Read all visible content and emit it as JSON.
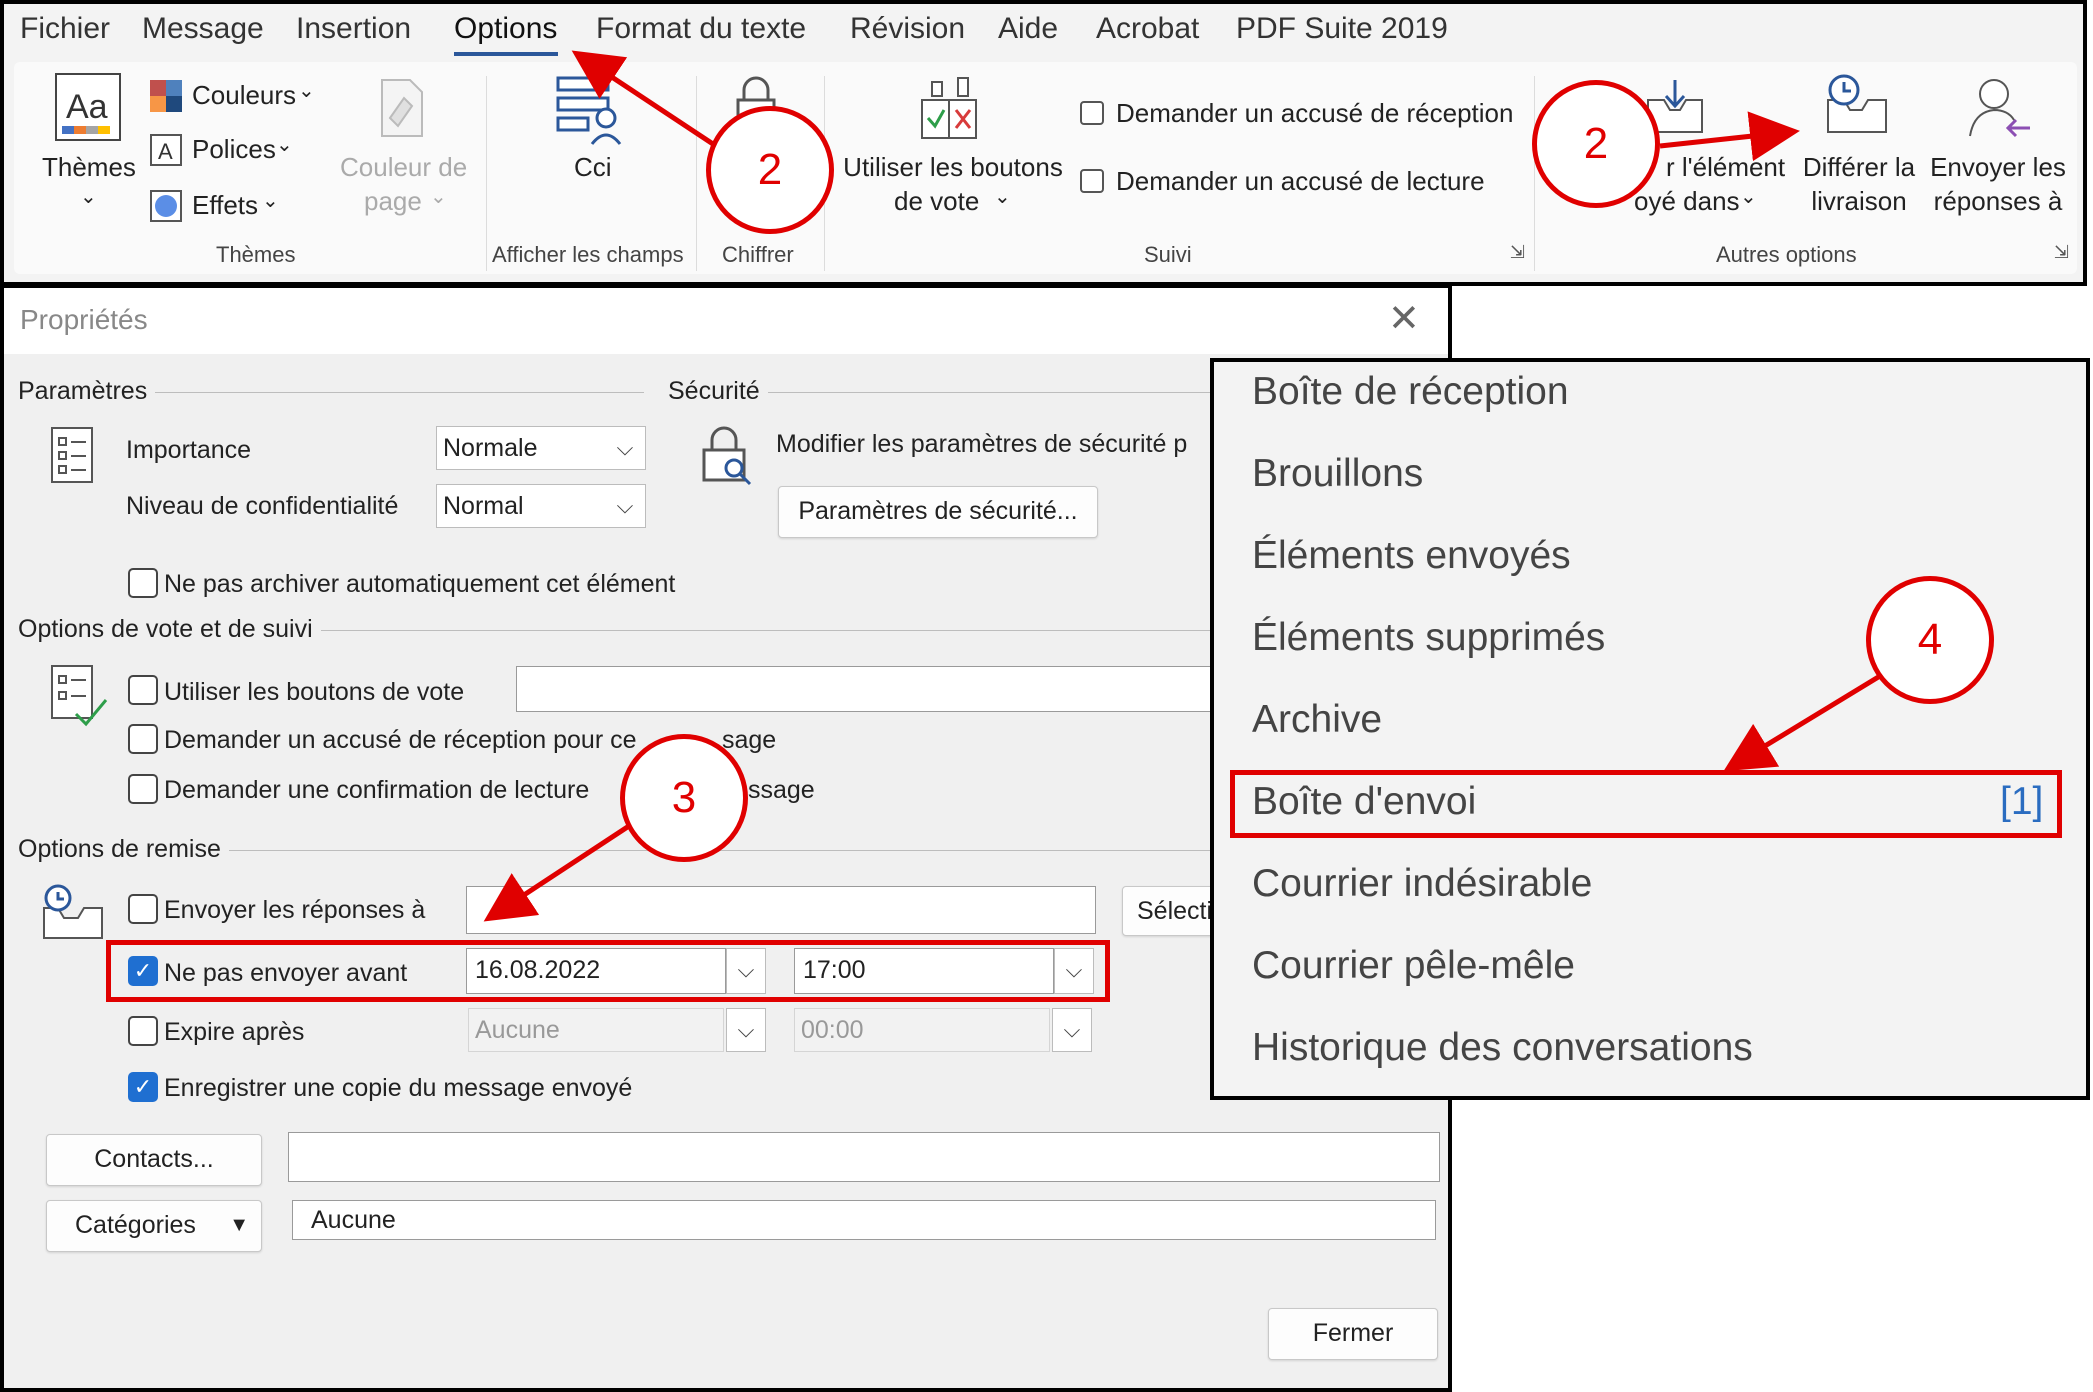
{
  "ribbon": {
    "tabs": [
      "Fichier",
      "Message",
      "Insertion",
      "Options",
      "Format du texte",
      "Révision",
      "Aide",
      "Acrobat",
      "PDF Suite 2019"
    ],
    "active_tab": "Options",
    "themes": {
      "themes_label": "Thèmes",
      "colors_label": "Couleurs",
      "fonts_label": "Polices",
      "effects_label": "Effets",
      "page_color_line1": "Couleur de",
      "page_color_line2": "page",
      "group_label": "Thèmes"
    },
    "show_fields": {
      "bcc_label": "Cci",
      "group_label": "Afficher les champs"
    },
    "encrypt": {
      "group_label": "Chiffrer"
    },
    "tracking": {
      "voting_line1": "Utiliser les boutons",
      "voting_line2": "de vote",
      "delivery_receipt": "Demander un accusé de réception",
      "read_receipt": "Demander un accusé de lecture",
      "group_label": "Suivi"
    },
    "more_options": {
      "save_sent_line1": "r l'élément",
      "save_sent_line2": "oyé dans",
      "delay_line1": "Différer la",
      "delay_line2": "livraison",
      "reply_line1": "Envoyer les",
      "reply_line2": "réponses à",
      "group_label": "Autres options"
    }
  },
  "dialog": {
    "title": "Propriétés",
    "settings_section": "Paramètres",
    "importance_label": "Importance",
    "importance_value": "Normale",
    "sensitivity_label": "Niveau de confidentialité",
    "sensitivity_value": "Normal",
    "security_section": "Sécurité",
    "security_text": "Modifier les paramètres de sécurité p",
    "security_button": "Paramètres de sécurité...",
    "no_autoarchive": "Ne pas archiver automatiquement cet élément",
    "voting_section": "Options de vote et de suivi",
    "use_voting": "Utiliser les boutons de vote",
    "delivery_receipt": "Demander un accusé de réception pour ce",
    "delivery_receipt_tail": "sage",
    "read_receipt": "Demander une confirmation de lecture",
    "read_receipt_tail": "ssage",
    "delivery_section": "Options de remise",
    "replies_to": "Envoyer les réponses à",
    "select_names": "Sélecti",
    "do_not_deliver_before": "Ne pas envoyer avant",
    "deliver_date": "16.08.2022",
    "deliver_time": "17:00",
    "expires_after": "Expire après",
    "expire_date": "Aucune",
    "expire_time": "00:00",
    "save_copy": "Enregistrer une copie du message envoyé",
    "contacts_button": "Contacts...",
    "categories_button": "Catégories",
    "categories_value": "Aucune",
    "close_button": "Fermer"
  },
  "folders": {
    "items": [
      "Boîte de réception",
      "Brouillons",
      "Éléments envoyés",
      "Éléments supprimés",
      "Archive",
      "Boîte d'envoi",
      "Courrier indésirable",
      "Courrier pêle-mêle",
      "Historique des conversations"
    ],
    "outbox_count": "[1]"
  },
  "annotations": {
    "step_a": "2",
    "step_b": "2",
    "step_c": "3",
    "step_d": "4"
  },
  "colors": {
    "annotation": "#e00000",
    "accent": "#2b579a",
    "checkbox": "#1f6fd1",
    "count": "#2a6cc0"
  }
}
